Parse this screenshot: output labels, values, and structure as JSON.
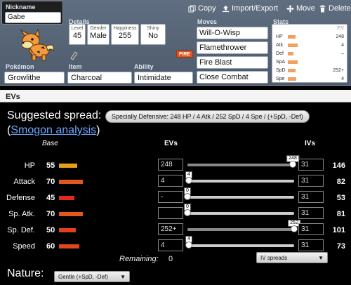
{
  "nickname": {
    "label": "Nickname",
    "value": "Gabe"
  },
  "toolbar": {
    "copy": "Copy",
    "import_export": "Import/Export",
    "move": "Move",
    "delete": "Delete"
  },
  "sections": {
    "details": "Details",
    "moves": "Moves",
    "stats": "Stats",
    "pokemon": "Pokémon",
    "item": "Item",
    "ability": "Ability"
  },
  "details": {
    "level_label": "Level",
    "level": "45",
    "gender_label": "Gender",
    "gender": "Male",
    "happiness_label": "Happiness",
    "happiness": "255",
    "shiny_label": "Shiny",
    "shiny": "No"
  },
  "type_badge": "FIRE",
  "pokemon": "Growlithe",
  "item": "Charcoal",
  "ability": "Intimidate",
  "moves": [
    "Will-O-Wisp",
    "Flamethrower",
    "Fire Blast",
    "Close Combat"
  ],
  "stats_panel": {
    "ev_header": "EV",
    "rows": [
      {
        "name": "HP",
        "ev": "248",
        "bar_pct": 0.35
      },
      {
        "name": "Atk",
        "ev": "4",
        "bar_pct": 0.45
      },
      {
        "name": "Def",
        "ev": "–",
        "bar_pct": 0.28
      },
      {
        "name": "SpA",
        "ev": "",
        "bar_pct": 0.45
      },
      {
        "name": "SpD",
        "ev": "252+",
        "bar_pct": 0.38
      },
      {
        "name": "Spe",
        "ev": "4",
        "bar_pct": 0.4
      }
    ]
  },
  "ev_section": {
    "title": "EVs",
    "suggested_label": "Suggested spread:",
    "suggested_spread": "Specially Defensive: 248 HP / 4 Atk / 252 SpD / 4 Spe / (+SpD, -Def)",
    "smogon_open": "(",
    "smogon_link": "Smogon analysis",
    "smogon_close": ")",
    "col_base": "Base",
    "col_evs": "EVs",
    "col_ivs": "IVs",
    "remaining_label": "Remaining:",
    "remaining_value": "0",
    "iv_spreads": "IV spreads",
    "nature_label": "Nature:",
    "nature_value": "Gentle (+SpD, -Def)"
  },
  "stat_rows": [
    {
      "name": "HP",
      "base": "55",
      "base_color": "#e6a017",
      "base_frac": 0.55,
      "ev": "248",
      "ev_frac": 0.984,
      "tip": "248",
      "iv": "31",
      "total": "146"
    },
    {
      "name": "Attack",
      "base": "70",
      "base_color": "#e0581b",
      "base_frac": 0.7,
      "ev": "4",
      "ev_frac": 0.016,
      "tip": "4",
      "iv": "31",
      "total": "82"
    },
    {
      "name": "Defense",
      "base": "45",
      "base_color": "#e0281b",
      "base_frac": 0.45,
      "ev": "-",
      "ev_frac": 0.0,
      "tip": "0",
      "iv": "31",
      "total": "53"
    },
    {
      "name": "Sp. Atk.",
      "base": "70",
      "base_color": "#e0581b",
      "base_frac": 0.7,
      "ev": "",
      "ev_frac": 0.0,
      "tip": "0",
      "iv": "31",
      "total": "81"
    },
    {
      "name": "Sp. Def.",
      "base": "50",
      "base_color": "#e0401b",
      "base_frac": 0.5,
      "ev": "252+",
      "ev_frac": 1.0,
      "tip": "252",
      "iv": "31",
      "total": "101"
    },
    {
      "name": "Speed",
      "base": "60",
      "base_color": "#e0481b",
      "base_frac": 0.6,
      "ev": "4",
      "ev_frac": 0.016,
      "tip": "4",
      "iv": "31",
      "total": "73"
    }
  ],
  "colors": {
    "panel": "#56657a",
    "link": "#69a8ff",
    "badge_fire": "#e4541b",
    "stat_bar": "#f0a060"
  }
}
